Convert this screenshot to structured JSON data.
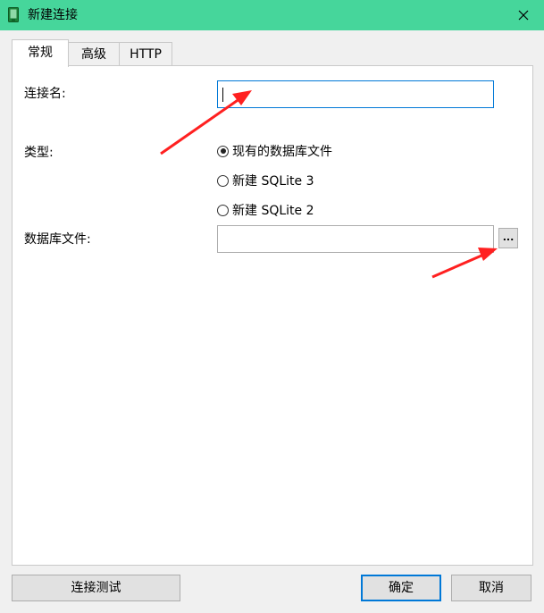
{
  "window": {
    "title": "新建连接",
    "accent_color": "#46d69b"
  },
  "tabs": [
    {
      "label": "常规",
      "active": true
    },
    {
      "label": "高级",
      "active": false
    },
    {
      "label": "HTTP",
      "active": false
    }
  ],
  "form": {
    "connection_name_label": "连接名:",
    "connection_name_value": "",
    "type_label": "类型:",
    "type_options": [
      {
        "label": "现有的数据库文件",
        "checked": true
      },
      {
        "label": "新建 SQLite 3",
        "checked": false
      },
      {
        "label": "新建 SQLite 2",
        "checked": false
      }
    ],
    "db_file_label": "数据库文件:",
    "db_file_value": "",
    "browse_label": "..."
  },
  "footer": {
    "test_button_label": "连接测试",
    "ok_button_label": "确定",
    "cancel_button_label": "取消"
  },
  "annotations": {
    "arrow_color": "#ff2020"
  }
}
